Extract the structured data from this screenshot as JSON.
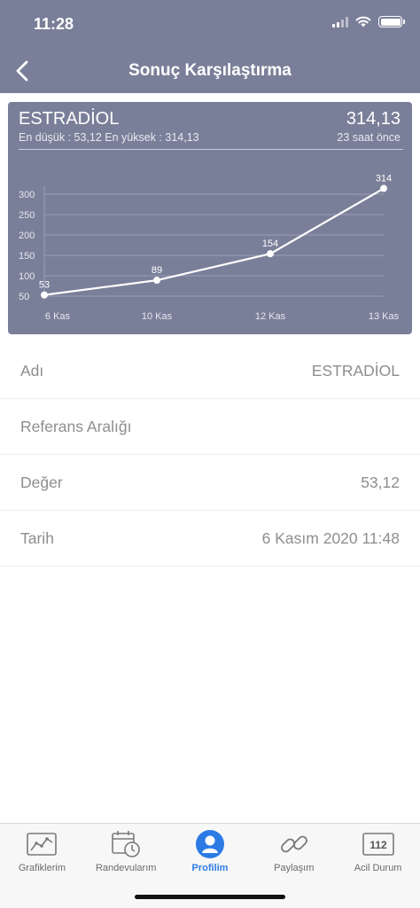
{
  "status_bar": {
    "time": "11:28"
  },
  "nav": {
    "title": "Sonuç Karşılaştırma"
  },
  "card": {
    "name": "ESTRADİOL",
    "value": "314,13",
    "minmax": "En düşük : 53,12 En yüksek : 314,13",
    "time_ago": "23 saat önce"
  },
  "chart_data": {
    "type": "line",
    "categories": [
      "6 Kas",
      "10 Kas",
      "12 Kas",
      "13 Kas"
    ],
    "values": [
      53,
      89,
      154,
      314
    ],
    "data_labels": [
      "53",
      "89",
      "154",
      "314"
    ],
    "y_ticks": [
      50,
      100,
      150,
      200,
      250,
      300
    ],
    "ylim": [
      50,
      300
    ],
    "grid": true,
    "line_color": "#ffffff",
    "background": "#7a7f99"
  },
  "details": [
    {
      "label": "Adı",
      "value": "ESTRADİOL"
    },
    {
      "label": "Referans Aralığı",
      "value": ""
    },
    {
      "label": "Değer",
      "value": "53,12"
    },
    {
      "label": "Tarih",
      "value": "6 Kasım 2020 11:48"
    }
  ],
  "tabs": [
    {
      "label": "Grafiklerim",
      "icon": "chart-icon"
    },
    {
      "label": "Randevularım",
      "icon": "calendar-clock-icon"
    },
    {
      "label": "Profilim",
      "icon": "profile-icon",
      "active": true
    },
    {
      "label": "Paylaşım",
      "icon": "link-icon"
    },
    {
      "label": "Acil Durum",
      "icon": "emergency-112-icon",
      "badge": "112"
    }
  ],
  "colors": {
    "header": "#7a7f99",
    "active_tab": "#2c7be5"
  }
}
